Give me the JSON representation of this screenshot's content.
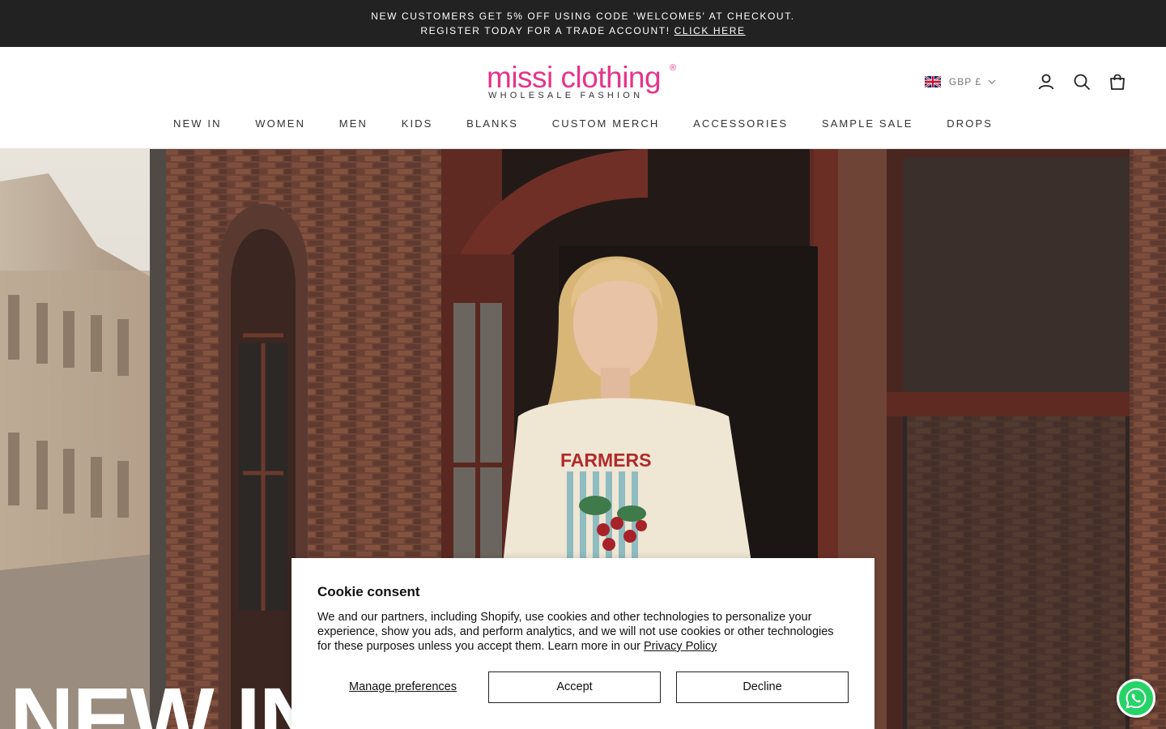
{
  "announcement": {
    "line1": "NEW CUSTOMERS GET 5% OFF USING CODE 'WELCOME5' AT CHECKOUT.",
    "line2_text": "REGISTER TODAY FOR A TRADE ACCOUNT! ",
    "line2_link": "CLICK HERE"
  },
  "header": {
    "logo": {
      "main": "missi clothing",
      "mark": "®",
      "sub": "WHOLESALE FASHION"
    },
    "currency": {
      "label": "GBP £",
      "flag_icon": "uk-flag-icon"
    },
    "icons": [
      "account-icon",
      "search-icon",
      "cart-icon"
    ]
  },
  "nav": {
    "items": [
      {
        "label": "NEW IN"
      },
      {
        "label": "WOMEN"
      },
      {
        "label": "MEN"
      },
      {
        "label": "KIDS"
      },
      {
        "label": "BLANKS"
      },
      {
        "label": "CUSTOM MERCH"
      },
      {
        "label": "ACCESSORIES"
      },
      {
        "label": "SAMPLE SALE"
      },
      {
        "label": "DROPS"
      }
    ]
  },
  "hero": {
    "heading": "NEW IN"
  },
  "cookie": {
    "title": "Cookie consent",
    "body": "We and our partners, including Shopify, use cookies and other technologies to personalize your experience, show you ads, and perform analytics, and we will not use cookies or other technologies for these purposes unless you accept them. Learn more in our ",
    "policy_link": "Privacy Policy",
    "manage_label": "Manage preferences",
    "accept_label": "Accept",
    "decline_label": "Decline"
  },
  "colors": {
    "brand_pink": "#e6338c",
    "announcement_bg": "#222222",
    "whatsapp_green": "#25d366"
  }
}
